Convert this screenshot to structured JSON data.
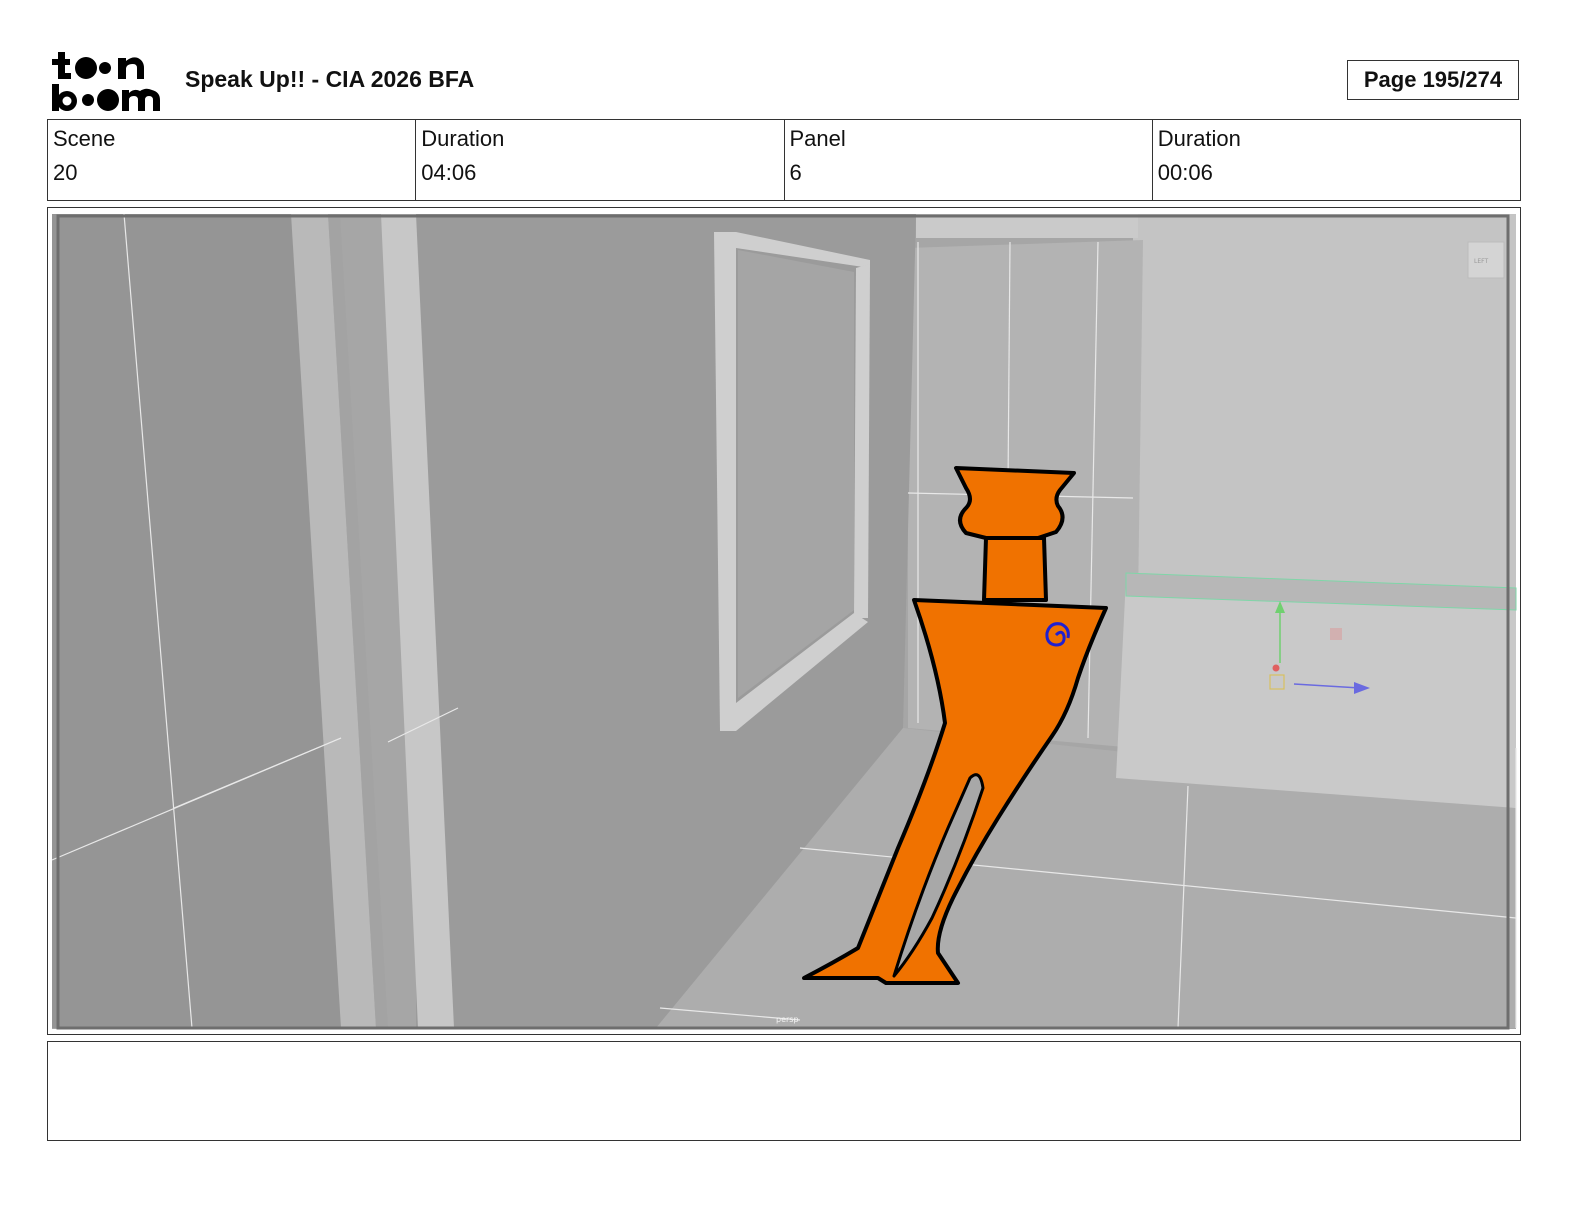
{
  "header": {
    "logo_text": "toon boom",
    "title": "Speak Up!! - CIA 2026 BFA",
    "page_label": "Page 195/274"
  },
  "info": {
    "scene_label": "Scene",
    "scene_value": "20",
    "scene_duration_label": "Duration",
    "scene_duration_value": "04:06",
    "panel_label": "Panel",
    "panel_value": "6",
    "panel_duration_label": "Duration",
    "panel_duration_value": "00:06"
  },
  "viewport": {
    "camera_label": "persp",
    "view_cube_label": "LEFT"
  },
  "notes": {
    "text": ""
  },
  "colors": {
    "character_fill": "#f07200",
    "character_outline": "#000000",
    "mark": "#2020d0",
    "wall_dark": "#9a9a9a",
    "wall_light": "#c6c6c6"
  }
}
